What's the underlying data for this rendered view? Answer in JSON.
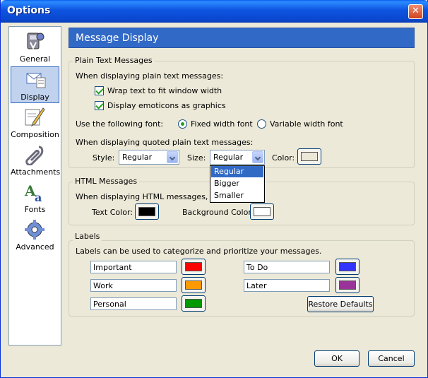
{
  "window": {
    "title": "Options",
    "close_glyph": "✕"
  },
  "sidebar": {
    "items": [
      {
        "label": "General",
        "icon": "general-icon"
      },
      {
        "label": "Display",
        "icon": "display-icon",
        "selected": true
      },
      {
        "label": "Composition",
        "icon": "composition-icon"
      },
      {
        "label": "Attachments",
        "icon": "attachments-icon"
      },
      {
        "label": "Fonts",
        "icon": "fonts-icon"
      },
      {
        "label": "Advanced",
        "icon": "advanced-icon"
      }
    ]
  },
  "header": {
    "title": "Message Display"
  },
  "plain_text": {
    "legend": "Plain Text Messages",
    "intro": "When displaying plain text messages:",
    "wrap_label": "Wrap text to fit window width",
    "wrap_checked": true,
    "emoticons_label": "Display emoticons as graphics",
    "emoticons_checked": true,
    "font_label": "Use the following font:",
    "fixed_label": "Fixed width font",
    "variable_label": "Variable width font",
    "font_selected": "fixed",
    "quoted_label": "When displaying quoted plain text messages:",
    "style_label": "Style:",
    "style_value": "Regular",
    "size_label": "Size:",
    "size_value": "Regular",
    "color_label": "Color:",
    "quoted_color": "#ece9d8",
    "size_options": [
      "Regular",
      "Bigger",
      "Smaller"
    ]
  },
  "html_messages": {
    "legend": "HTML Messages",
    "intro": "When displaying HTML messages, use th",
    "text_color_label": "Text Color:",
    "text_color": "#000000",
    "bg_color_label": "Background Color:",
    "bg_color": "#ffffff"
  },
  "labels": {
    "legend": "Labels",
    "intro": "Labels can be used to categorize and prioritize your messages.",
    "items": [
      {
        "name": "Important",
        "color": "#ff0000"
      },
      {
        "name": "Work",
        "color": "#ff9900"
      },
      {
        "name": "Personal",
        "color": "#009900"
      },
      {
        "name": "To Do",
        "color": "#3333ff"
      },
      {
        "name": "Later",
        "color": "#993399"
      }
    ],
    "restore_label": "Restore Defaults"
  },
  "footer": {
    "ok_label": "OK",
    "cancel_label": "Cancel"
  }
}
